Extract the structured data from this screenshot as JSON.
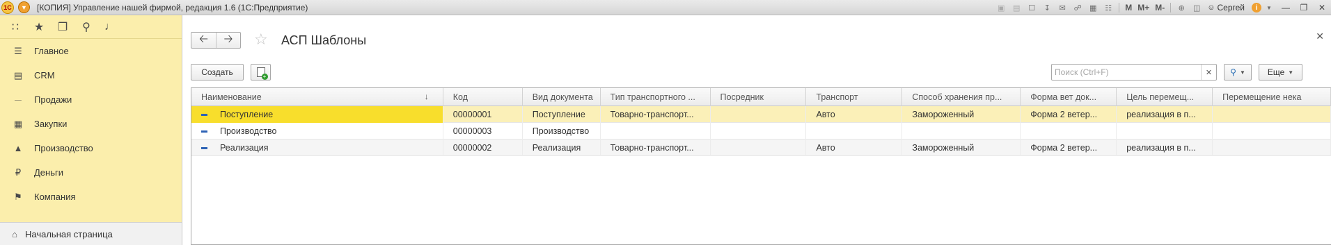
{
  "window": {
    "logo_text": "1С",
    "title": "[КОПИЯ] Управление нашей фирмой, редакция 1.6  (1С:Предприятие)",
    "toolbar": {
      "m": "M",
      "m_plus": "M+",
      "m_minus": "M-"
    },
    "user": "Сергей"
  },
  "sidebar": {
    "items": [
      {
        "label": "Главное",
        "icon": "menu-lines-icon"
      },
      {
        "label": "CRM",
        "icon": "contacts-icon"
      },
      {
        "label": "Продажи",
        "icon": "basket-icon"
      },
      {
        "label": "Закупки",
        "icon": "warehouse-icon"
      },
      {
        "label": "Производство",
        "icon": "factory-icon"
      },
      {
        "label": "Деньги",
        "icon": "ruble-icon"
      },
      {
        "label": "Компания",
        "icon": "flag-icon"
      }
    ],
    "home": "Начальная страница"
  },
  "page": {
    "title": "АСП Шаблоны",
    "create_label": "Создать",
    "more_label": "Еще",
    "search_placeholder": "Поиск (Ctrl+F)"
  },
  "table": {
    "columns": [
      "Наименование",
      "Код",
      "Вид документа",
      "Тип транспортного ...",
      "Посредник",
      "Транспорт",
      "Способ хранения пр...",
      "Форма вет док...",
      "Цель перемещ...",
      "Перемещение нека"
    ],
    "rows": [
      [
        "Поступление",
        "00000001",
        "Поступление",
        "Товарно-транспорт...",
        "",
        "Авто",
        "Замороженный",
        "Форма 2 ветер...",
        "реализация в п...",
        ""
      ],
      [
        "Производство",
        "00000003",
        "Производство",
        "",
        "",
        "",
        "",
        "",
        "",
        ""
      ],
      [
        "Реализация",
        "00000002",
        "Реализация",
        "Товарно-транспорт...",
        "",
        "Авто",
        "Замороженный",
        "Форма 2 ветер...",
        "реализация в п...",
        ""
      ]
    ],
    "selected_row": 0
  },
  "colors": {
    "sidebar_bg": "#fbeeac",
    "selected_row": "#fbf0b8",
    "selected_cell": "#f8de2c",
    "row_mark": "#2d62b5"
  }
}
